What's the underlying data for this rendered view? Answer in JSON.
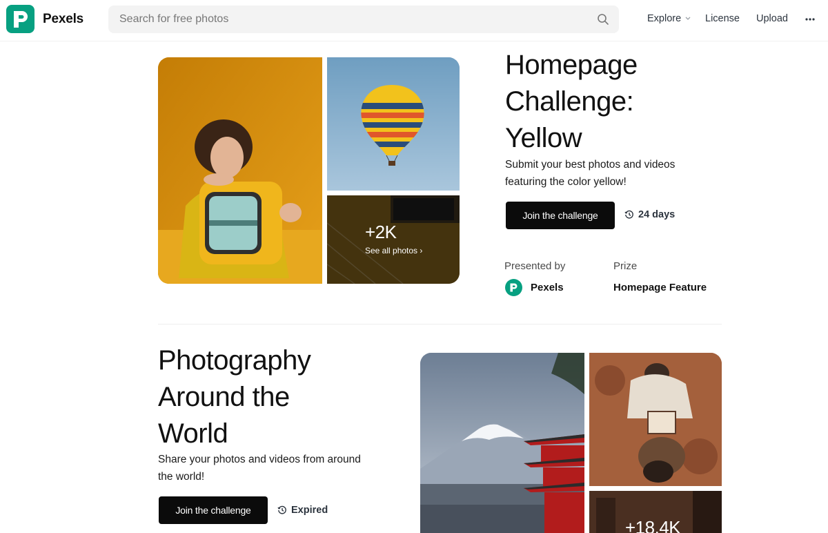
{
  "header": {
    "brand": "Pexels",
    "search_placeholder": "Search for free photos",
    "nav": {
      "explore": "Explore",
      "license": "License",
      "upload": "Upload"
    },
    "icons": [
      "pexels-logo-icon",
      "search-icon",
      "chevron-down-icon",
      "more-icon"
    ]
  },
  "challenges": [
    {
      "title_lines": [
        "Homepage",
        "Challenge:",
        "Yellow"
      ],
      "description_lines": [
        "Submit your best photos and videos",
        "featuring the color yellow!"
      ],
      "button_label": "Join the challenge",
      "status": "24 days",
      "photo_count": "+2K",
      "see_all_label": "See all photos ›",
      "presented_by_label": "Presented by",
      "presenter": "Pexels",
      "prize_label": "Prize",
      "prize": "Homepage Feature"
    },
    {
      "title_lines": [
        "Photography",
        "Around the",
        "World"
      ],
      "description_lines": [
        "Share your photos and videos from around",
        "the world!"
      ],
      "button_label": "Join the challenge",
      "status": "Expired",
      "photo_count": "+18.4K"
    }
  ],
  "colors": {
    "brand_green": "#07a081",
    "button_black": "#0b0b0b",
    "yellow_bg": "#d8950e",
    "sky_blue": "#7ea9c8"
  }
}
